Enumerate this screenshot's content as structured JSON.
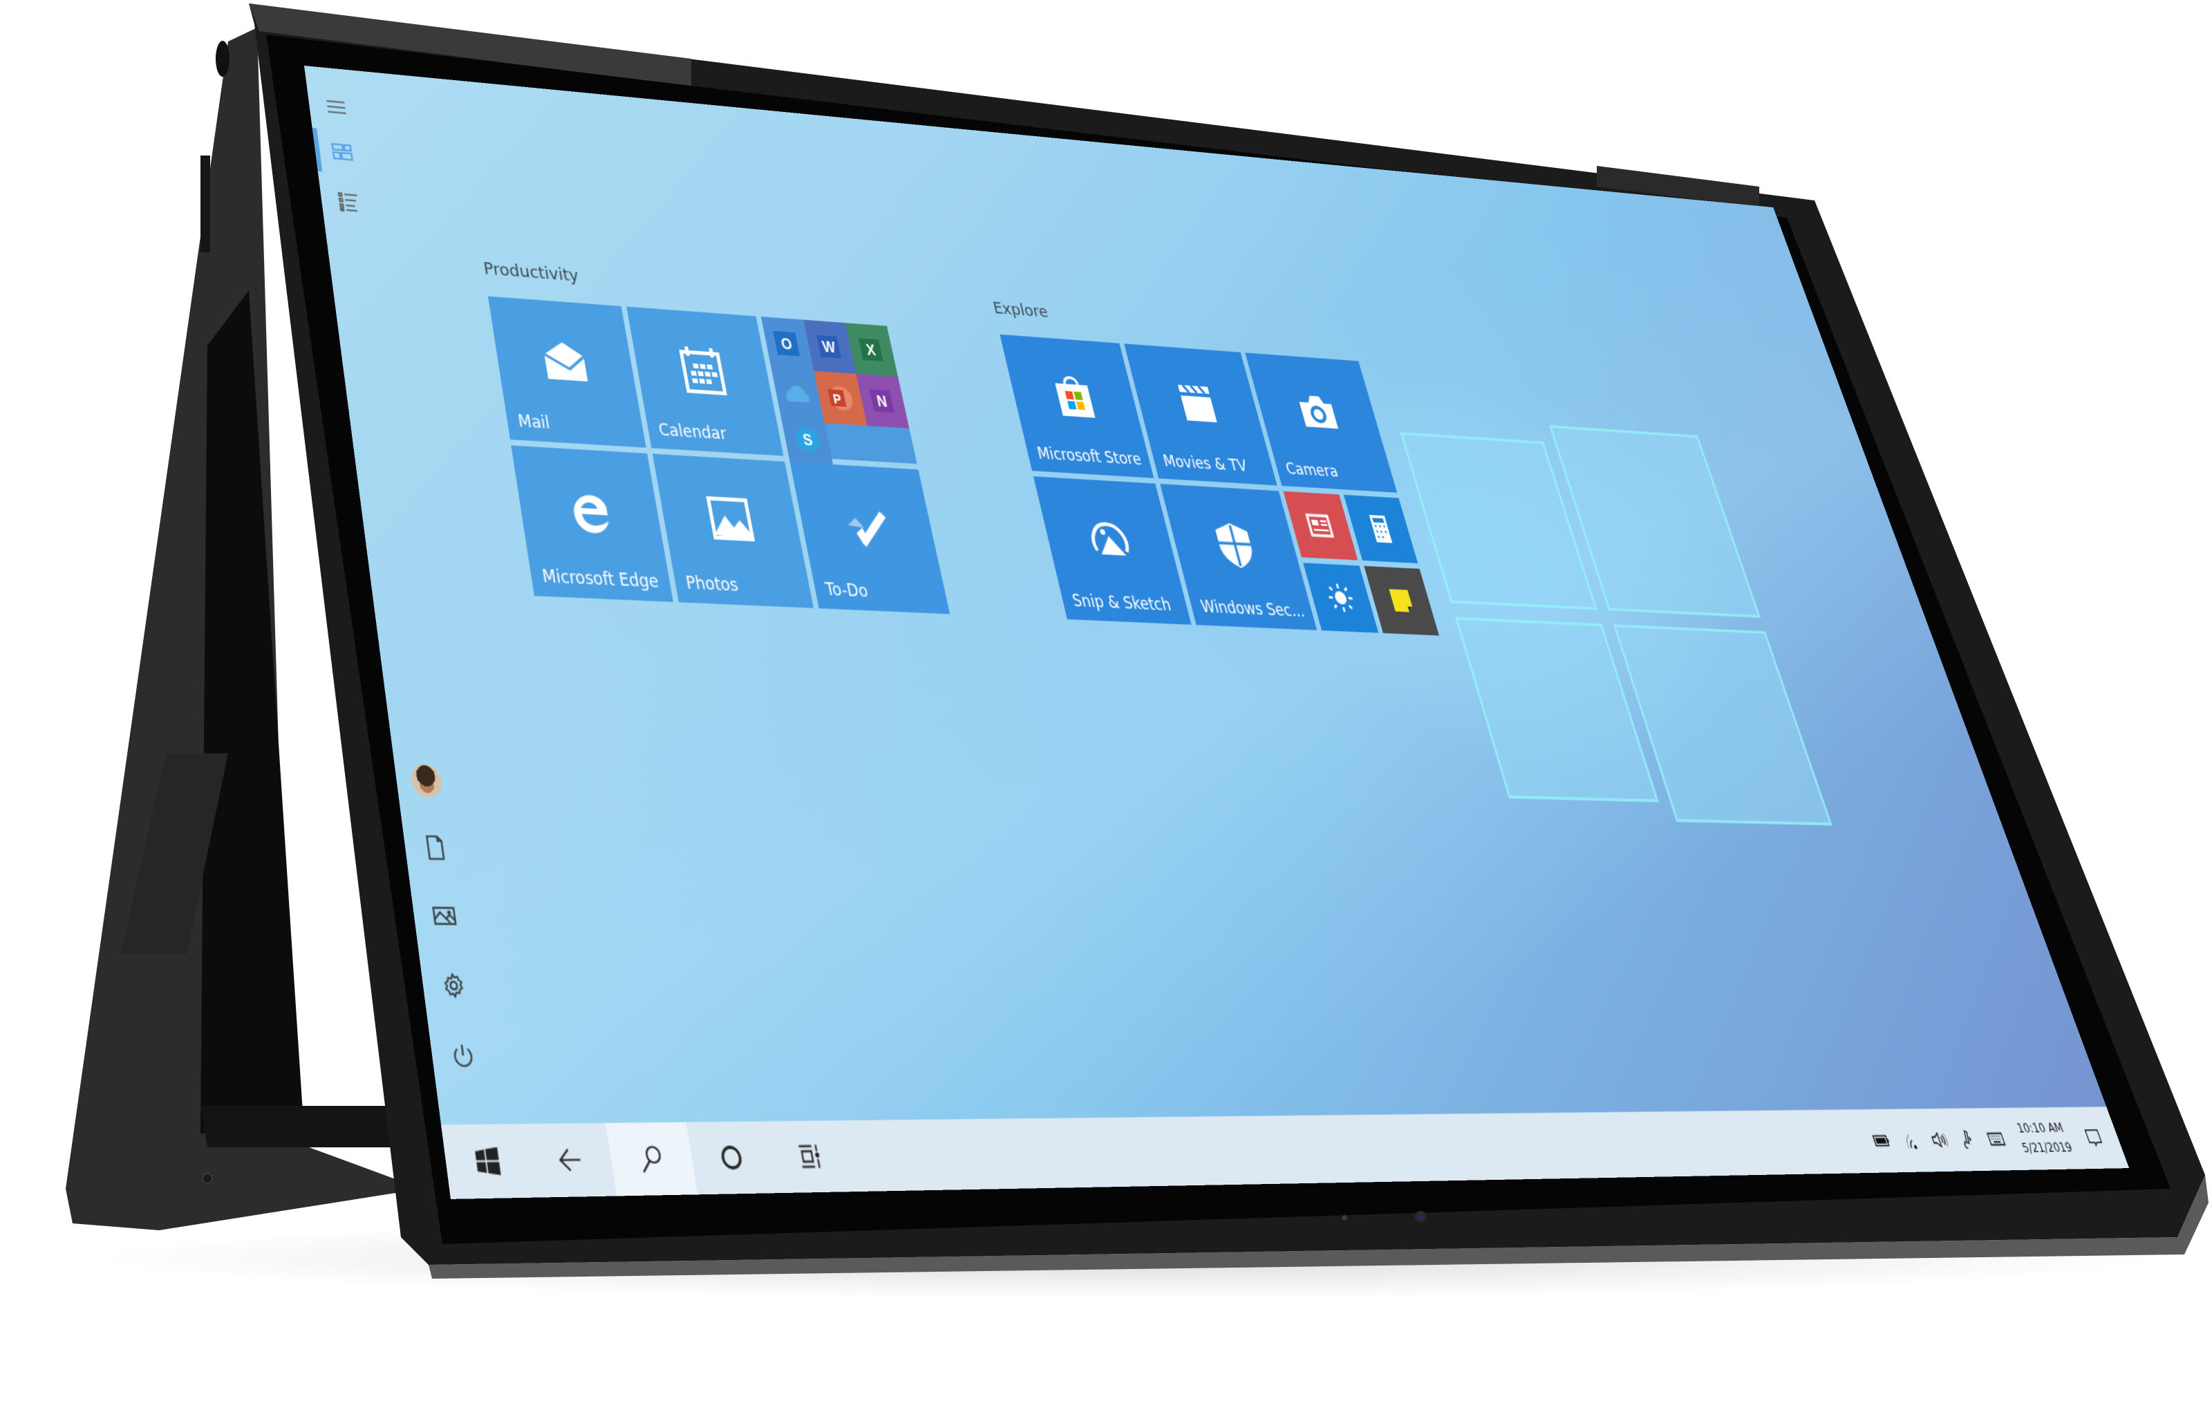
{
  "device": {
    "brand_logo": "hp-logo-icon",
    "mode": "tent"
  },
  "colors": {
    "accent": "#5aa3e6",
    "tile": "#4a9ee2",
    "tile_explore": "#2b86dc",
    "news_tile": "#d64e52",
    "sticky_tile": "#4a4a4a",
    "sticky_note": "#f7e01c",
    "taskbar": "#dde9f2"
  },
  "start_rail": {
    "top_items": [
      {
        "name": "hamburger-menu-icon",
        "label": "Expand"
      },
      {
        "name": "tiles-view-icon",
        "label": "Pinned tiles",
        "selected": true
      },
      {
        "name": "all-apps-list-icon",
        "label": "All apps"
      }
    ],
    "bottom_items": [
      {
        "name": "user-avatar",
        "label": "User"
      },
      {
        "name": "documents-icon",
        "label": "Documents"
      },
      {
        "name": "pictures-icon",
        "label": "Pictures"
      },
      {
        "name": "settings-icon",
        "label": "Settings"
      },
      {
        "name": "power-icon",
        "label": "Power"
      }
    ]
  },
  "groups": [
    {
      "title": "Productivity",
      "tiles": [
        {
          "label": "Mail",
          "icon": "mail-icon"
        },
        {
          "label": "Calendar",
          "icon": "calendar-icon"
        },
        {
          "label": "Office",
          "icon": "office-folder-icon",
          "apps": [
            "Outlook",
            "Word",
            "Excel",
            "OneDrive",
            "PowerPoint",
            "OneNote",
            "Skype"
          ],
          "app_letters": [
            "O",
            "W",
            "X",
            "",
            "P",
            "N",
            "S"
          ]
        },
        {
          "label": "Microsoft Edge",
          "icon": "edge-icon"
        },
        {
          "label": "Photos",
          "icon": "photos-icon"
        },
        {
          "label": "To-Do",
          "icon": "todo-check-icon"
        }
      ]
    },
    {
      "title": "Explore",
      "tiles": [
        {
          "label": "Microsoft Store",
          "icon": "store-bag-icon"
        },
        {
          "label": "Movies & TV",
          "icon": "clapper-icon"
        },
        {
          "label": "Camera",
          "icon": "camera-icon"
        },
        {
          "label": "Snip & Sketch",
          "icon": "snip-sketch-icon"
        },
        {
          "label": "Windows Sec...",
          "icon": "shield-icon"
        },
        {
          "label": "News",
          "icon": "news-icon"
        },
        {
          "label": "Calculator",
          "icon": "calculator-icon"
        },
        {
          "label": "Weather",
          "icon": "weather-sun-icon"
        },
        {
          "label": "Sticky Notes",
          "icon": "sticky-notes-icon"
        }
      ]
    }
  ],
  "taskbar": {
    "buttons": [
      {
        "name": "start-button",
        "icon": "windows-logo-icon"
      },
      {
        "name": "back-button",
        "icon": "back-arrow-icon"
      },
      {
        "name": "search-button",
        "icon": "search-icon",
        "active": true
      },
      {
        "name": "cortana-button",
        "icon": "cortana-circle-icon"
      },
      {
        "name": "task-view-button",
        "icon": "task-view-icon"
      }
    ],
    "tray": [
      {
        "name": "battery-icon"
      },
      {
        "name": "wifi-icon"
      },
      {
        "name": "volume-icon"
      },
      {
        "name": "pen-ink-workspace-icon"
      },
      {
        "name": "touch-keyboard-icon"
      }
    ],
    "time": "10:10 AM",
    "date": "5/21/2019",
    "notification_icon": "action-center-icon"
  }
}
